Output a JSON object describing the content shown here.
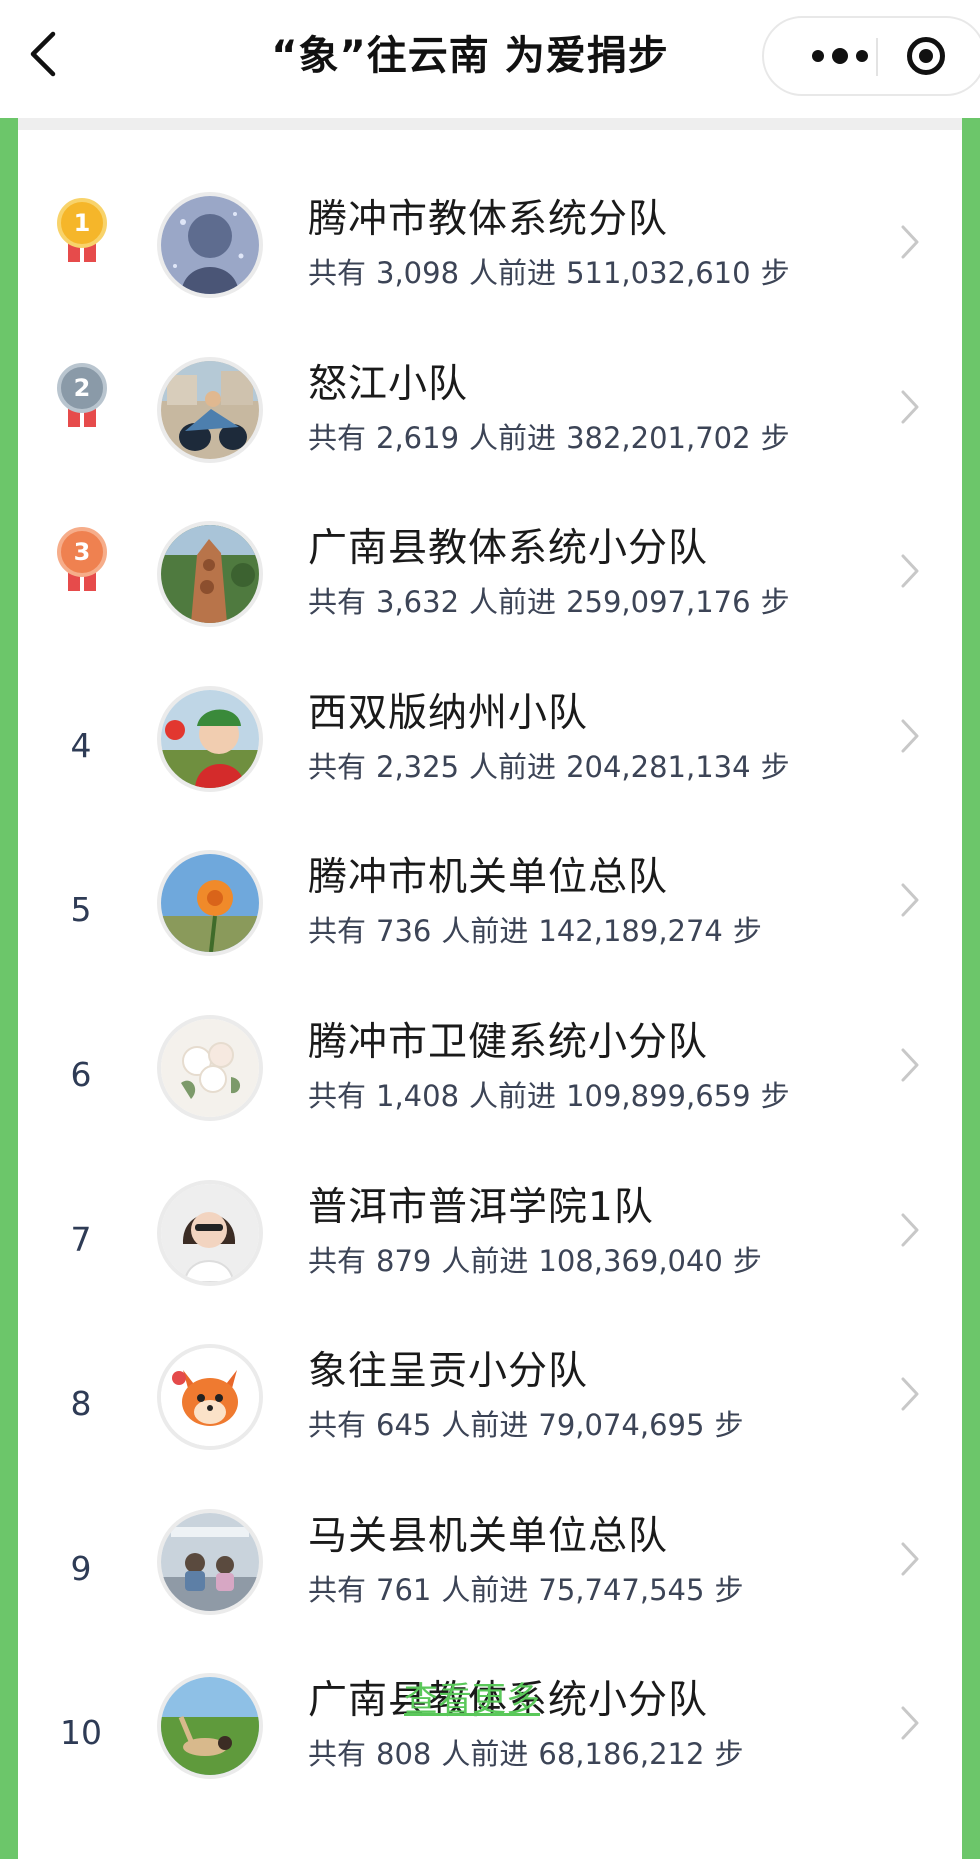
{
  "nav": {
    "title": "“象”往云南 为爱捐步",
    "back_icon": "chevron-left-icon",
    "more_icon": "more-dots-icon",
    "close_icon": "mini-program-close-icon"
  },
  "colors": {
    "frame_green": "#6cc66a",
    "link_green": "#5ac85a",
    "gold": "#f5b62a",
    "silver": "#8a9aa8",
    "bronze": "#ef8150"
  },
  "labels": {
    "prefix": "共有",
    "people_suffix": "人前进",
    "steps_suffix": "步"
  },
  "teams": [
    {
      "rank": "1",
      "name": "腾冲市教体系统分队",
      "people": "3,098",
      "steps": "511,032,610",
      "medal": "gold"
    },
    {
      "rank": "2",
      "name": "怒江小队",
      "people": "2,619",
      "steps": "382,201,702",
      "medal": "silver"
    },
    {
      "rank": "3",
      "name": "广南县教体系统小分队",
      "people": "3,632",
      "steps": "259,097,176",
      "medal": "bronze"
    },
    {
      "rank": "4",
      "name": "西双版纳州小队",
      "people": "2,325",
      "steps": "204,281,134",
      "medal": ""
    },
    {
      "rank": "5",
      "name": "腾冲市机关单位总队",
      "people": "736",
      "steps": "142,189,274",
      "medal": ""
    },
    {
      "rank": "6",
      "name": "腾冲市卫健系统小分队",
      "people": "1,408",
      "steps": "109,899,659",
      "medal": ""
    },
    {
      "rank": "7",
      "name": "普洱市普洱学院1队",
      "people": "879",
      "steps": "108,369,040",
      "medal": ""
    },
    {
      "rank": "8",
      "name": "象往呈贡小分队",
      "people": "645",
      "steps": "79,074,695",
      "medal": ""
    },
    {
      "rank": "9",
      "name": "马关县机关单位总队",
      "people": "761",
      "steps": "75,747,545",
      "medal": ""
    },
    {
      "rank": "10",
      "name": "广南县教体系统小分队",
      "people": "808",
      "steps": "68,186,212",
      "medal": ""
    }
  ],
  "footer": {
    "more_label": "查看更多"
  }
}
